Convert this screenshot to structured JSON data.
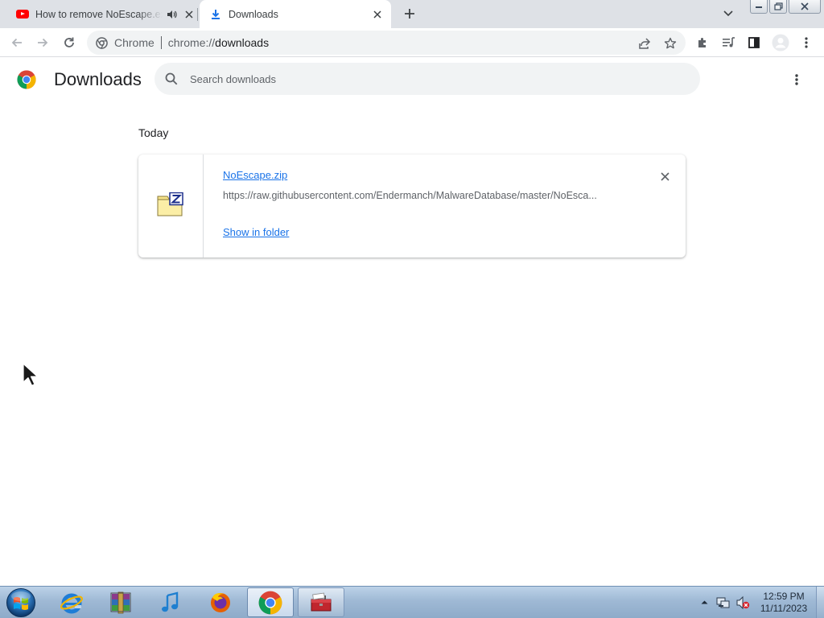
{
  "browser": {
    "tabs": [
      {
        "title": "How to remove NoEscape.exe",
        "icon": "youtube-icon",
        "audio_icon": "speaker-icon",
        "active": false
      },
      {
        "title": "Downloads",
        "icon": "download-icon",
        "active": true
      }
    ],
    "omnibox": {
      "chip": "Chrome",
      "url_scheme": "chrome://",
      "url_host": "downloads"
    }
  },
  "page": {
    "title": "Downloads",
    "search": {
      "placeholder": "Search downloads",
      "value": ""
    }
  },
  "downloads": {
    "date_heading": "Today",
    "items": [
      {
        "filename": "NoEscape.zip",
        "url": "https://raw.githubusercontent.com/Endermanch/MalwareDatabase/master/NoEsca...",
        "action_label": "Show in folder",
        "icon": "zip-file-icon"
      }
    ]
  },
  "taskbar": {
    "apps": [
      "internet-explorer-icon",
      "winrar-icon",
      "itunes-icon",
      "firefox-icon",
      "chrome-icon",
      "toolbox-icon"
    ],
    "active_app": "chrome-icon",
    "clock": {
      "time": "12:59 PM",
      "date": "11/11/2023"
    }
  },
  "colors": {
    "accent": "#1a73e8",
    "tabstrip": "#dee1e6",
    "omnibox": "#f1f3f4",
    "taskbar": "#9fb9d5"
  }
}
